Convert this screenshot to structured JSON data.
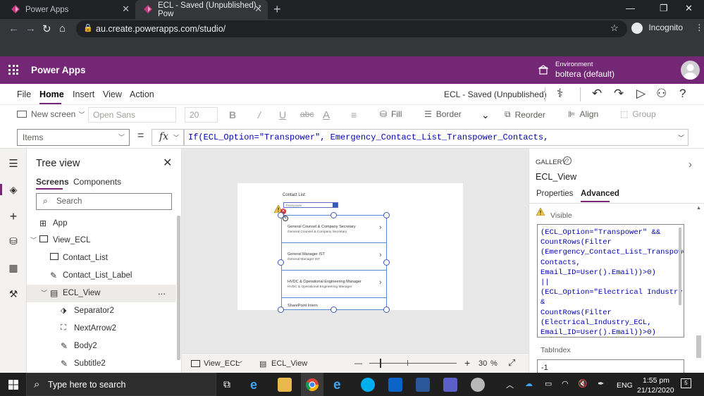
{
  "browser": {
    "tabs": [
      {
        "title": "Power Apps"
      },
      {
        "title": "ECL - Saved (Unpublished) - Pow"
      }
    ],
    "url": "au.create.powerapps.com/studio/",
    "profile": "Incognito",
    "new_tab": "+"
  },
  "header": {
    "app_name": "Power Apps",
    "environment_label": "Environment",
    "environment_value": "boltera (default)"
  },
  "menu": {
    "items": [
      "File",
      "Home",
      "Insert",
      "View",
      "Action"
    ],
    "status": "ECL - Saved (Unpublished)"
  },
  "ribbon": {
    "new_screen": "New screen",
    "font": "Open Sans",
    "font_size": "20",
    "fill": "Fill",
    "border": "Border",
    "reorder": "Reorder",
    "align": "Align",
    "group": "Group"
  },
  "formula_bar": {
    "property": "Items",
    "equals": "=",
    "fx": "fx",
    "formula": "If(ECL_Option=\"Transpower\", Emergency_Contact_List_Transpower_Contacts,"
  },
  "tree": {
    "title": "Tree view",
    "tabs": [
      "Screens",
      "Components"
    ],
    "search_placeholder": "Search",
    "nodes": [
      "App",
      "View_ECL",
      "Contact_List",
      "Contact_List_Label",
      "ECL_View",
      "Separator2",
      "NextArrow2",
      "Body2",
      "Subtitle2"
    ],
    "more": "..."
  },
  "canvas": {
    "contact_label": "Contact List:",
    "dropdown_value": "Transpower",
    "gallery_items": [
      {
        "title": "General Counsel & Company Secretary",
        "subtitle": "General Counsel & Company Secretary"
      },
      {
        "title": "General Manager IST",
        "subtitle": "General Manager IST"
      },
      {
        "title": "HVDC & Operational Engineering Manager",
        "subtitle": "HVDC & Operational Engineering Manager"
      },
      {
        "title": "SharePoint Intern",
        "subtitle": ""
      }
    ]
  },
  "canvas_status": {
    "screen": "View_ECL",
    "control": "ECL_View",
    "zoom": "30",
    "zoom_unit": "%",
    "minus": "—",
    "plus": "+"
  },
  "properties": {
    "kind": "GALLERY",
    "name": "ECL_View",
    "tabs": [
      "Properties",
      "Advanced"
    ],
    "visible_label": "Visible",
    "visible_formula": "(ECL_Option=\"Transpower\" &&\nCountRows(Filter\n(Emergency_Contact_List_Transpower_\nContacts,\nEmail_ID=User().Email))>0)\n||\n(ECL_Option=\"Electrical Industry\" &\n&\nCountRows(Filter\n(Electrical_Industry_ECL,\nEmail_ID=User().Email))>0)",
    "tabindex_label": "TabIndex",
    "tabindex_value": "-1"
  },
  "taskbar": {
    "search_placeholder": "Type here to search",
    "language": "ENG",
    "time": "1:55 pm",
    "date": "21/12/2020",
    "notifications": "5"
  },
  "colors": {
    "brand": "#742774",
    "selection": "#3b5ab6",
    "error": "#d13438",
    "warning": "#f2c94c"
  }
}
